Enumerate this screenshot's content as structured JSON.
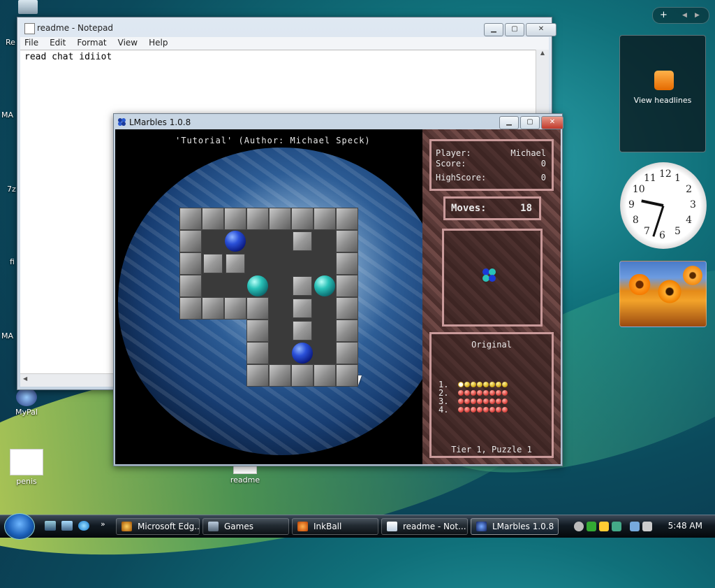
{
  "desktop": {
    "icons": [
      {
        "label": "MyPal"
      },
      {
        "label": "penis"
      },
      {
        "label": "readme"
      }
    ],
    "partial_labels": [
      "Re",
      "MA",
      "7z",
      "fi",
      "MA"
    ]
  },
  "notepad": {
    "title": "readme - Notepad",
    "menu": [
      "File",
      "Edit",
      "Format",
      "View",
      "Help"
    ],
    "content": "read chat idiiot"
  },
  "lmarbles": {
    "title": "LMarbles 1.0.8",
    "puzzle_title": "'Tutorial' (Author: Michael Speck)",
    "stats": {
      "player_label": "Player:",
      "player_value": "Michael",
      "score_label": "Score:",
      "score_value": "0",
      "highscore_label": "HighScore:",
      "highscore_value": "0"
    },
    "moves_label": "Moves:",
    "moves_value": "18",
    "level_set": "Original",
    "tiers": [
      "1.",
      "2.",
      "3.",
      "4."
    ],
    "tier_progress": {
      "solved_tier1": 0,
      "total_per_tier": 8
    },
    "status": "Tier 1, Puzzle 1",
    "colors": {
      "blue_marble": "#2a50d8",
      "cyan_marble": "#2ac2b8",
      "panel_border": "#c99a9a"
    }
  },
  "gadgets": {
    "feed_label": "View headlines",
    "clock_numbers": [
      "12",
      "1",
      "2",
      "3",
      "4",
      "5",
      "6",
      "7",
      "8",
      "9",
      "10",
      "11"
    ],
    "clock_time": "5:48"
  },
  "taskbar": {
    "buttons": [
      {
        "label": "Microsoft Edg...",
        "icon": "edge-icon"
      },
      {
        "label": "Games",
        "icon": "games-folder-icon"
      },
      {
        "label": "InkBall",
        "icon": "inkball-icon"
      },
      {
        "label": "readme - Not...",
        "icon": "notepad-icon"
      },
      {
        "label": "LMarbles 1.0.8",
        "icon": "lmarbles-icon"
      }
    ],
    "time": "5:48 AM"
  }
}
